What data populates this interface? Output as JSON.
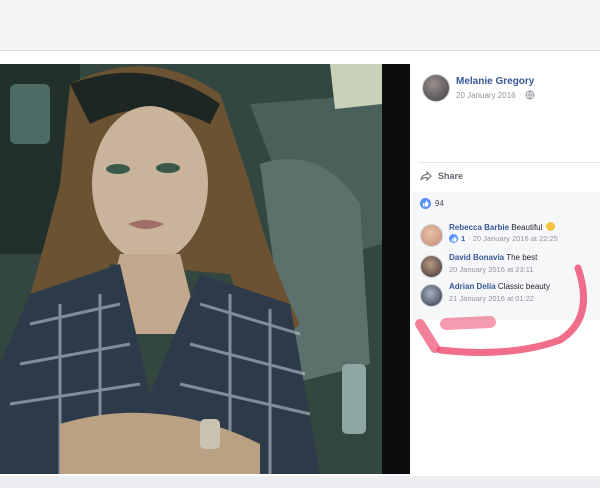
{
  "post": {
    "author": "Melanie Gregory",
    "date": "20 January 2016",
    "share_label": "Share",
    "like_count": "94"
  },
  "comments": [
    {
      "name": "Rebecca Barbie",
      "text": "Beautiful",
      "likes": "1",
      "meta": "· 20 January 2016 at 22:25"
    },
    {
      "name": "David Bonavia",
      "text": "The best",
      "meta": "20 January 2016 at 23:11"
    },
    {
      "name": "Adrian Delia",
      "text": "Classic beauty",
      "meta": "21 January 2016 at 01:22"
    }
  ],
  "icons": {
    "globe": "globe-icon",
    "share": "share-arrow-icon",
    "like": "thumbs-up-icon",
    "emoji": "heart-eyes-emoji-icon"
  },
  "colors": {
    "link_blue": "#365899",
    "like_blue": "#5890ff",
    "annotation": "#ee4a6e"
  }
}
